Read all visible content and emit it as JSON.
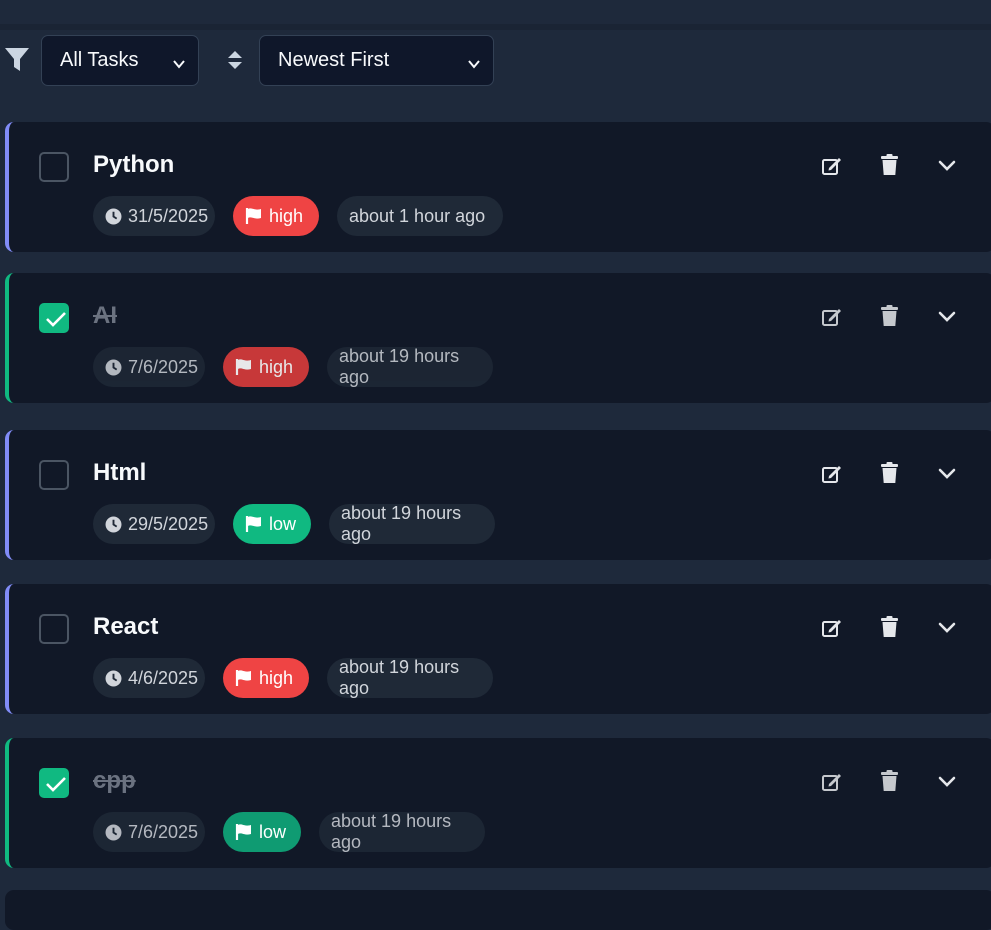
{
  "filter": {
    "selected": "All Tasks",
    "icon": "filter-icon"
  },
  "sort": {
    "selected": "Newest First",
    "icon": "sort-icon"
  },
  "colors": {
    "background": "#1e293b",
    "card": "#111827",
    "accent_pending": "#818cf8",
    "accent_done": "#10b981",
    "high": "#ef4444",
    "low": "#10b981"
  },
  "tasks": [
    {
      "title": "Python",
      "completed": false,
      "due": "31/5/2025",
      "priority": "high",
      "created": "about 1 hour ago"
    },
    {
      "title": "AI",
      "completed": true,
      "due": "7/6/2025",
      "priority": "high",
      "created": "about 19 hours ago"
    },
    {
      "title": "Html",
      "completed": false,
      "due": "29/5/2025",
      "priority": "low",
      "created": "about 19 hours ago"
    },
    {
      "title": "React",
      "completed": false,
      "due": "4/6/2025",
      "priority": "high",
      "created": "about 19 hours ago"
    },
    {
      "title": "cpp",
      "completed": true,
      "due": "7/6/2025",
      "priority": "low",
      "created": "about 19 hours ago"
    }
  ]
}
